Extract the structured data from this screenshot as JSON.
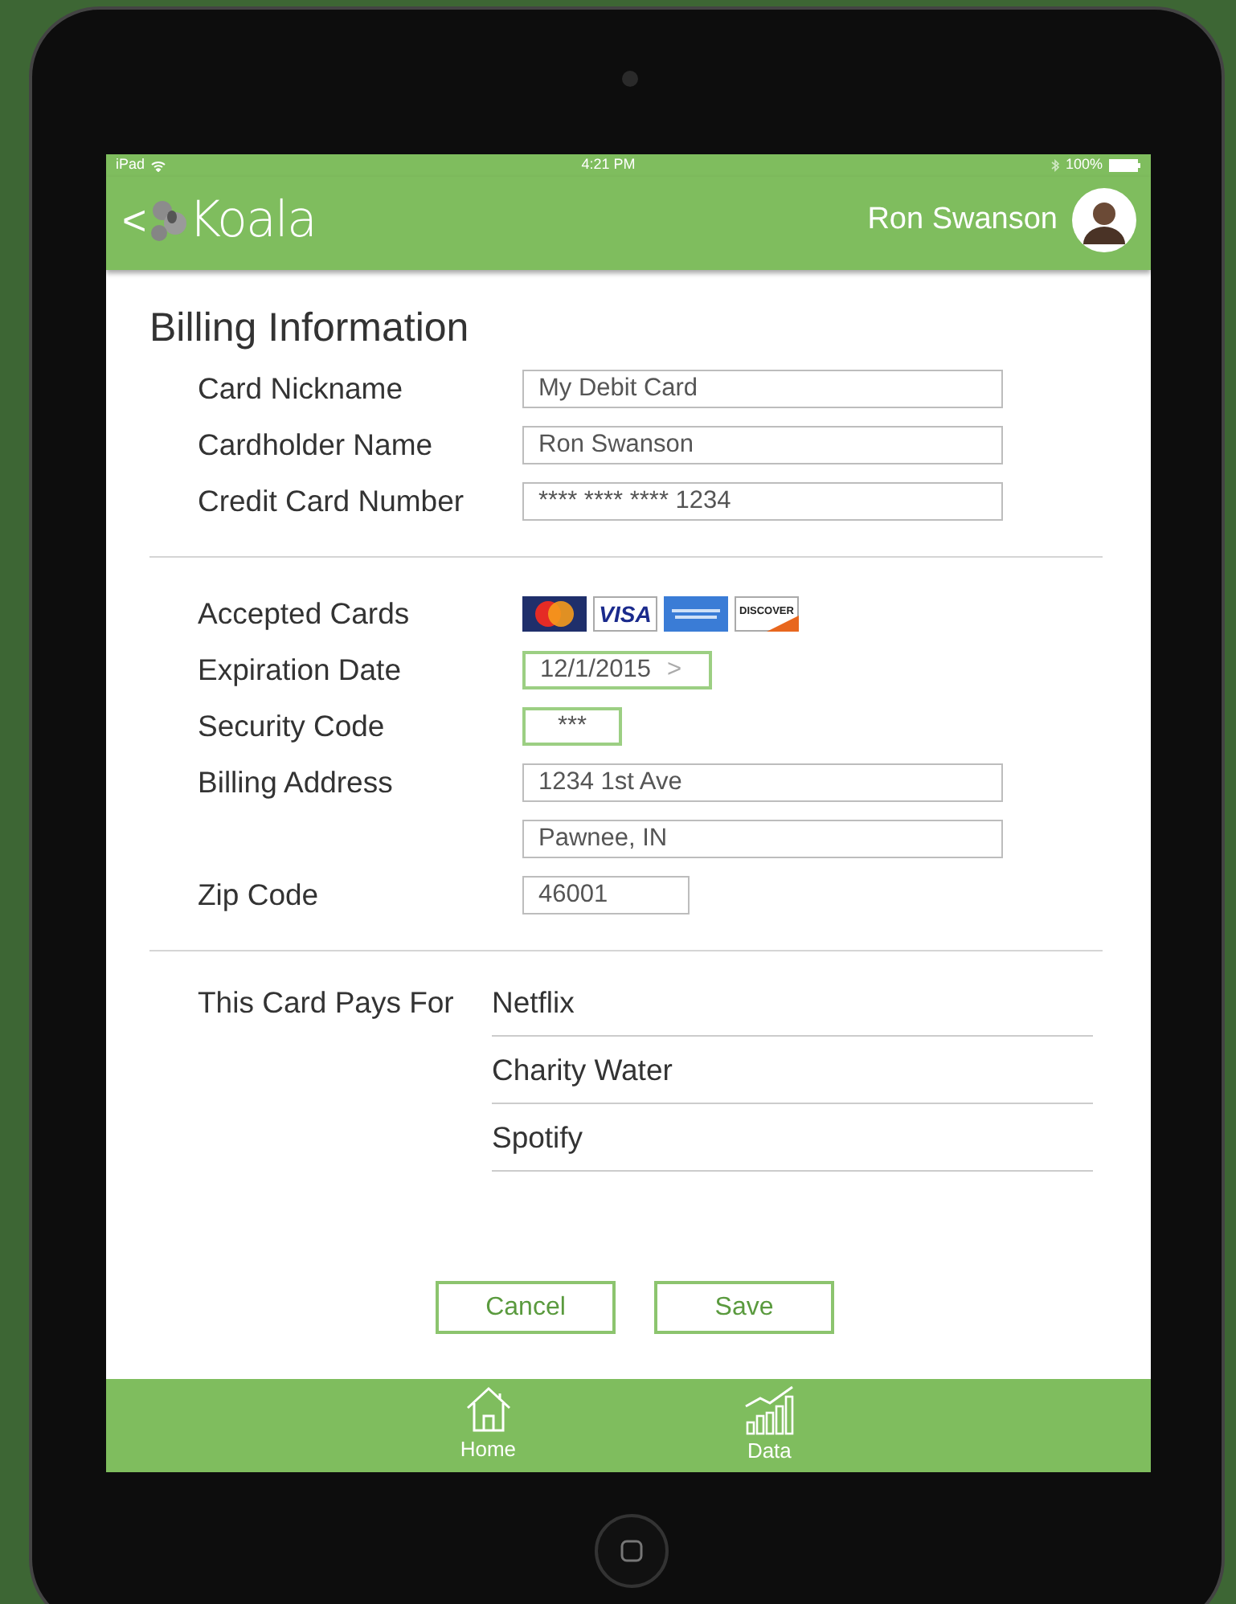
{
  "status_bar": {
    "carrier": "iPad",
    "time": "4:21 PM",
    "battery": "100%"
  },
  "header": {
    "back": "<",
    "app_name": "Koala",
    "user_name": "Ron Swanson"
  },
  "title": "Billing Information",
  "sections": [
    {
      "rows": [
        {
          "kind": "field",
          "label": "Card Nickname",
          "value": "My Debit Card"
        },
        {
          "kind": "field",
          "label": "Cardholder Name",
          "value": "Ron Swanson"
        },
        {
          "kind": "field",
          "label": "Credit Card Number",
          "value": "**** **** **** 1234"
        }
      ]
    },
    {
      "rows": [
        {
          "kind": "cards",
          "label": "Accepted Cards",
          "cards": [
            {
              "kind": "mastercard"
            },
            {
              "kind": "visa",
              "label": "VISA"
            },
            {
              "kind": "amex"
            },
            {
              "kind": "discover",
              "label": "DISCOVER"
            }
          ]
        },
        {
          "kind": "select",
          "label": "Expiration Date",
          "value": "12/1/2015",
          "chevron": ">"
        },
        {
          "kind": "code",
          "label": "Security Code",
          "value": "***"
        },
        {
          "kind": "field",
          "label": "Billing Address",
          "value": "1234 1st Ave"
        },
        {
          "kind": "continued",
          "value": "Pawnee, IN"
        },
        {
          "kind": "short",
          "label": "Zip Code",
          "value": "46001"
        }
      ]
    }
  ],
  "pays_for": {
    "label": "This Card Pays For",
    "items": [
      "Netflix",
      "Charity Water",
      "Spotify"
    ]
  },
  "buttons": [
    "Cancel",
    "Save"
  ],
  "tab_bar": [
    {
      "kind": "home",
      "label": "Home"
    },
    {
      "kind": "data",
      "label": "Data"
    }
  ]
}
